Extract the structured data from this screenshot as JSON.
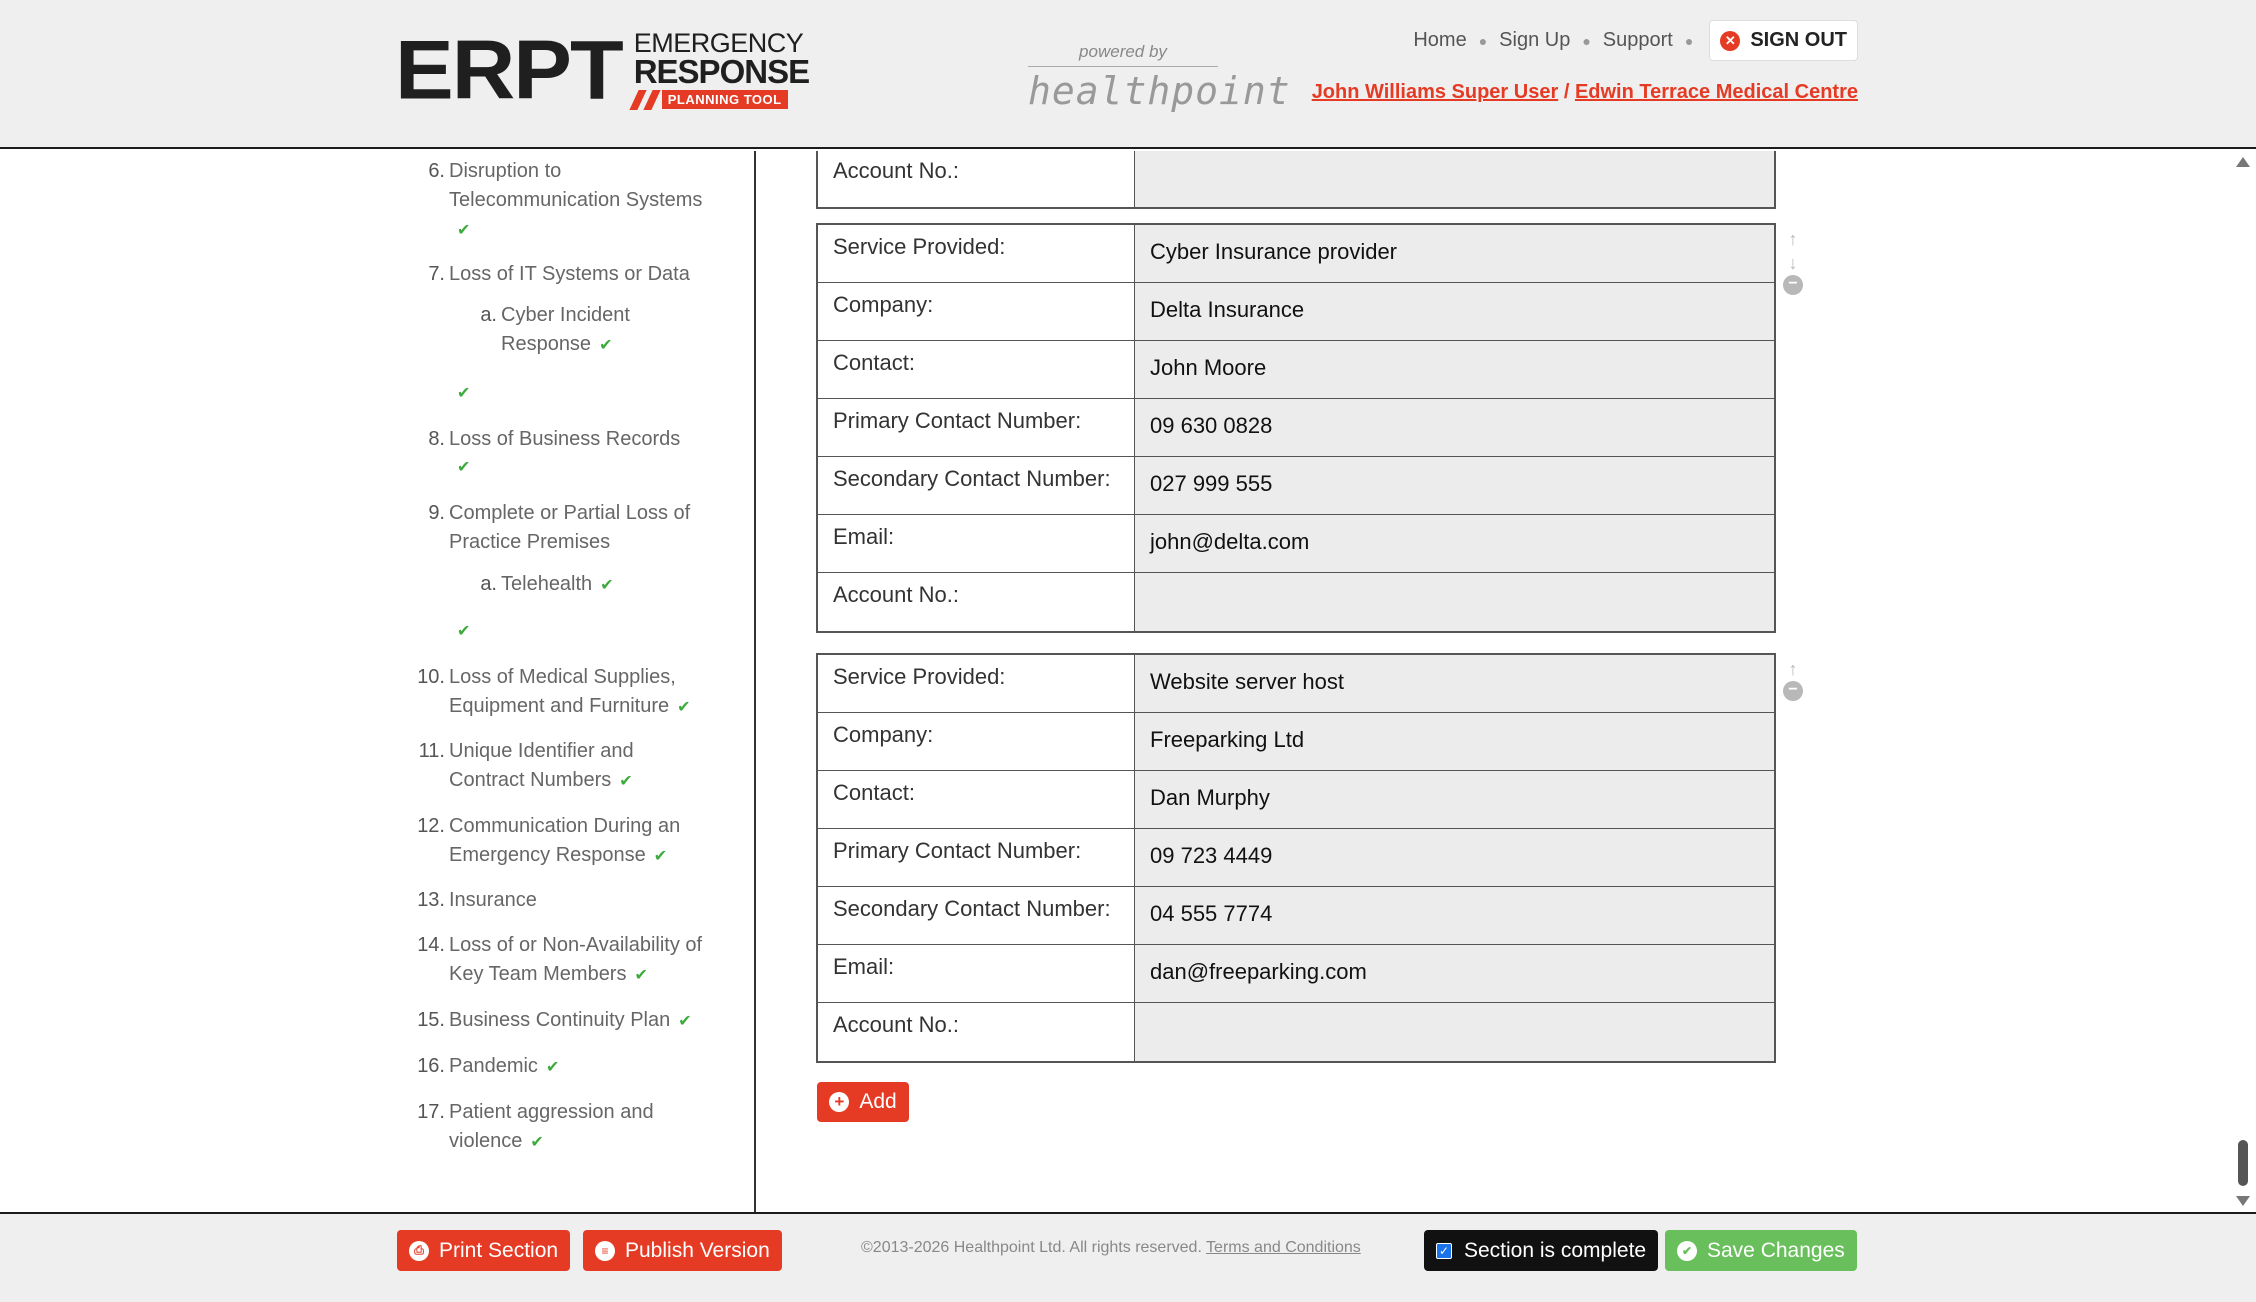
{
  "header": {
    "logo": {
      "main": "ERPT",
      "line1": "EMERGENCY",
      "line2": "RESPONSE",
      "line3": "PLANNING TOOL"
    },
    "powered": {
      "by": "powered by",
      "brand": "healthpoint"
    },
    "nav": {
      "home": "Home",
      "signup": "Sign Up",
      "support": "Support",
      "signout": "SIGN OUT"
    },
    "user": {
      "name": "John Williams Super User",
      "sep": "/",
      "practice": "Edwin Terrace Medical Centre"
    }
  },
  "sidebar": {
    "check": "✔",
    "items": [
      {
        "num": "6.",
        "line1": "Disruption to",
        "line2": "Telecommunication Systems"
      },
      {
        "num": "7.",
        "line1": "Loss of IT Systems or Data"
      },
      {
        "num": "a.",
        "line1": "Cyber Incident",
        "line2": "Response"
      },
      {
        "num": "8.",
        "line1": "Loss of Business Records"
      },
      {
        "num": "9.",
        "line1": "Complete or Partial Loss of",
        "line2": "Practice Premises"
      },
      {
        "num": "a.",
        "line1": "Telehealth"
      },
      {
        "num": "10.",
        "line1": "Loss of Medical Supplies,",
        "line2": "Equipment and Furniture"
      },
      {
        "num": "11.",
        "line1": "Unique Identifier and",
        "line2": "Contract Numbers"
      },
      {
        "num": "12.",
        "line1": "Communication During an",
        "line2": "Emergency Response"
      },
      {
        "num": "13.",
        "line1": "Insurance"
      },
      {
        "num": "14.",
        "line1": "Loss of or Non-Availability of",
        "line2": "Key Team Members"
      },
      {
        "num": "15.",
        "line1": "Business Continuity Plan"
      },
      {
        "num": "16.",
        "line1": "Pandemic"
      },
      {
        "num": "17.",
        "line1": "Patient aggression and",
        "line2": "violence"
      }
    ]
  },
  "labels": {
    "service": "Service Provided:",
    "company": "Company:",
    "contact": "Contact:",
    "primary": "Primary Contact Number:",
    "secondary": "Secondary Contact Number:",
    "email": "Email:",
    "account": "Account No.:"
  },
  "providers": [
    {
      "service": "",
      "company": "",
      "contact": "",
      "primary": "",
      "secondary": "",
      "email": "",
      "account": ""
    },
    {
      "service": "Cyber Insurance provider",
      "company": "Delta Insurance",
      "contact": "John Moore",
      "primary": "09 630 0828",
      "secondary": "027 999 555",
      "email": "john@delta.com",
      "account": ""
    },
    {
      "service": "Website server host",
      "company": "Freeparking Ltd",
      "contact": "Dan Murphy",
      "primary": "09 723 4449",
      "secondary": "04 555 7774",
      "email": "dan@freeparking.com",
      "account": ""
    }
  ],
  "controls": {
    "up": "↑",
    "down": "↓",
    "remove": "−"
  },
  "add_button": "Add",
  "footer": {
    "print": "Print Section",
    "publish": "Publish Version",
    "copyright": "©2013-2026 Healthpoint Ltd. All rights reserved.",
    "terms": "Terms and Conditions",
    "complete": "Section is complete",
    "save": "Save Changes"
  },
  "colors": {
    "accent": "#e53a24",
    "success": "#69bf5b",
    "check": "#3cab3c"
  }
}
